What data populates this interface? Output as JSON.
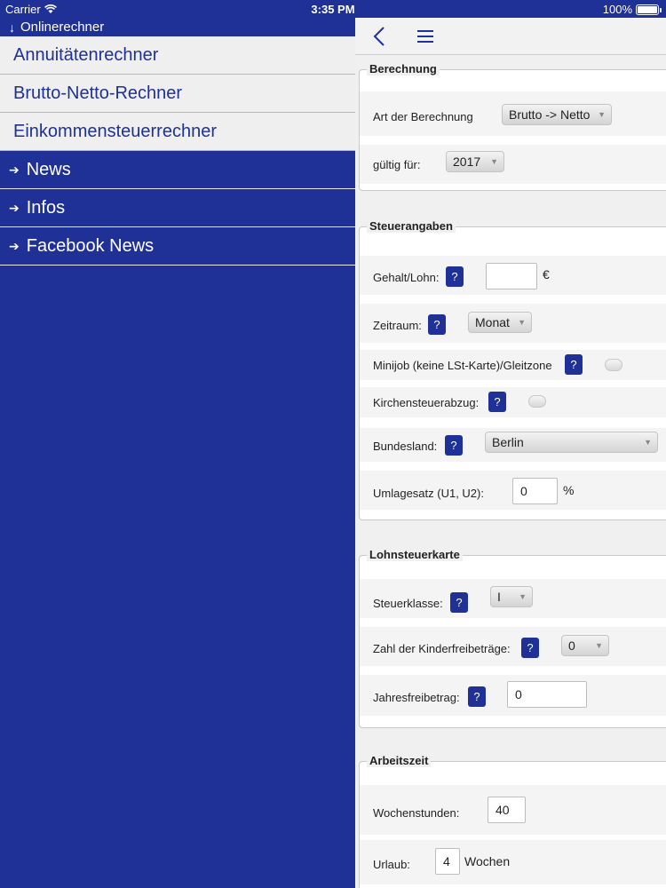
{
  "status": {
    "carrier": "Carrier",
    "time": "3:35 PM",
    "battery": "100%",
    "battery_level": 1.0
  },
  "menu": {
    "header": "Onlinerechner",
    "sub_items": [
      {
        "label": "Annuitätenrechner"
      },
      {
        "label": "Brutto-Netto-Rechner"
      },
      {
        "label": "Einkommensteuerrechner"
      }
    ],
    "main_items": [
      {
        "label": "News"
      },
      {
        "label": "Infos"
      },
      {
        "label": "Facebook News"
      }
    ]
  },
  "toolbar": {
    "back_icon": "chevron-left-icon",
    "menu_icon": "hamburger-icon"
  },
  "help_label": "?",
  "berechnung": {
    "legend": "Berechnung",
    "art_label": "Art der Berechnung",
    "art_value": "Brutto -> Netto",
    "gueltig_label": "gültig für:",
    "gueltig_value": "2017"
  },
  "steuerangaben": {
    "legend": "Steuerangaben",
    "gehalt_label": "Gehalt/Lohn:",
    "gehalt_value": "",
    "gehalt_unit": "€",
    "zeitraum_label": "Zeitraum:",
    "zeitraum_value": "Monat",
    "minijob_label": "Minijob (keine LSt-Karte)/Gleitzone",
    "kirchensteuer_label": "Kirchensteuerabzug:",
    "bundesland_label": "Bundesland:",
    "bundesland_value": "Berlin",
    "umlage_label": "Umlagesatz (U1, U2):",
    "umlage_value": "0",
    "umlage_unit": "%"
  },
  "lohnsteuerkarte": {
    "legend": "Lohnsteuerkarte",
    "steuerklasse_label": "Steuerklasse:",
    "steuerklasse_value": "I",
    "kinder_label": "Zahl der Kinderfreibeträge:",
    "kinder_value": "0",
    "jahres_label": "Jahresfreibetrag:",
    "jahres_value": "0"
  },
  "arbeitszeit": {
    "legend": "Arbeitszeit",
    "wochenstunden_label": "Wochenstunden:",
    "wochenstunden_value": "40",
    "urlaub_label": "Urlaub:",
    "urlaub_value": "4",
    "urlaub_unit": "Wochen"
  },
  "colors": {
    "brand": "#1f3197",
    "panel": "#f0f0f0"
  }
}
